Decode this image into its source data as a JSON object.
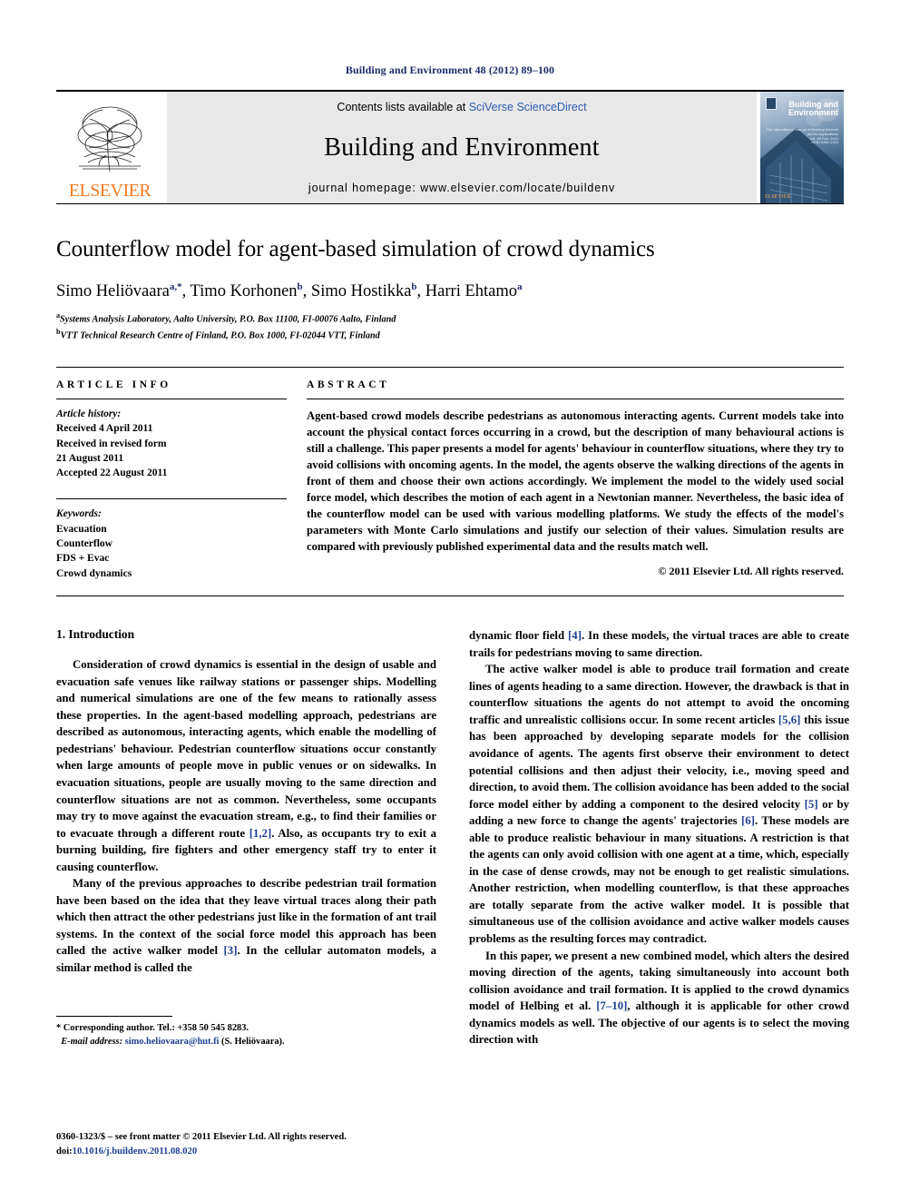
{
  "running_head": "Building and Environment 48 (2012) 89–100",
  "masthead": {
    "publisher_name": "ELSEVIER",
    "contents_prefix": "Contents lists available at ",
    "contents_link": "SciVerse ScienceDirect",
    "journal_title": "Building and Environment",
    "homepage_line": "journal homepage: www.elsevier.com/locate/buildenv",
    "cover_title_line1": "Building and",
    "cover_title_line2": "Environment",
    "cover_subtitle": "The International Journal of Building Science and its Applications",
    "cover_volume": "Vol. 48  Feb. 2012",
    "cover_issn": "ISSN 0360-1323",
    "cover_publisher": "ELSEVIER"
  },
  "article": {
    "title": "Counterflow model for agent-based simulation of crowd dynamics",
    "authors_html": "Simo Heliövaara<sup>a,*</sup>, Timo Korhonen<sup>b</sup>, Simo Hostikka<sup>b</sup>, Harri Ehtamo<sup>a</sup>",
    "affiliation_a": "Systems Analysis Laboratory, Aalto University, P.O. Box 11100, FI-00076 Aalto, Finland",
    "affiliation_b": "VTT Technical Research Centre of Finland, P.O. Box 1000, FI-02044 VTT, Finland"
  },
  "article_info": {
    "heading": "ARTICLE INFO",
    "history_label": "Article history:",
    "history": [
      "Received 4 April 2011",
      "Received in revised form",
      "21 August 2011",
      "Accepted 22 August 2011"
    ],
    "keywords_label": "Keywords:",
    "keywords": [
      "Evacuation",
      "Counterflow",
      "FDS + Evac",
      "Crowd dynamics"
    ]
  },
  "abstract": {
    "heading": "ABSTRACT",
    "text": "Agent-based crowd models describe pedestrians as autonomous interacting agents. Current models take into account the physical contact forces occurring in a crowd, but the description of many behavioural actions is still a challenge. This paper presents a model for agents' behaviour in counterflow situations, where they try to avoid collisions with oncoming agents. In the model, the agents observe the walking directions of the agents in front of them and choose their own actions accordingly. We implement the model to the widely used social force model, which describes the motion of each agent in a Newtonian manner. Nevertheless, the basic idea of the counterflow model can be used with various modelling platforms. We study the effects of the model's parameters with Monte Carlo simulations and justify our selection of their values. Simulation results are compared with previously published experimental data and the results match well.",
    "copyright": "© 2011 Elsevier Ltd. All rights reserved."
  },
  "body": {
    "section_title": "1. Introduction",
    "left_paragraphs": [
      "Consideration of crowd dynamics is essential in the design of usable and evacuation safe venues like railway stations or passenger ships. Modelling and numerical simulations are one of the few means to rationally assess these properties. In the agent-based modelling approach, pedestrians are described as autonomous, interacting agents, which enable the modelling of pedestrians' behaviour. Pedestrian counterflow situations occur constantly when large amounts of people move in public venues or on sidewalks. In evacuation situations, people are usually moving to the same direction and counterflow situations are not as common. Nevertheless, some occupants may try to move against the evacuation stream, e.g., to find their families or to evacuate through a different route [1,2]. Also, as occupants try to exit a burning building, fire fighters and other emergency staff try to enter it causing counterflow.",
      "Many of the previous approaches to describe pedestrian trail formation have been based on the idea that they leave virtual traces along their path which then attract the other pedestrians just like in the formation of ant trail systems. In the context of the social force model this approach has been called the active walker model [3]. In the cellular automaton models, a similar method is called the"
    ],
    "right_paragraphs": [
      "dynamic floor field [4]. In these models, the virtual traces are able to create trails for pedestrians moving to same direction.",
      "The active walker model is able to produce trail formation and create lines of agents heading to a same direction. However, the drawback is that in counterflow situations the agents do not attempt to avoid the oncoming traffic and unrealistic collisions occur. In some recent articles [5,6] this issue has been approached by developing separate models for the collision avoidance of agents. The agents first observe their environment to detect potential collisions and then adjust their velocity, i.e., moving speed and direction, to avoid them. The collision avoidance has been added to the social force model either by adding a component to the desired velocity [5] or by adding a new force to change the agents' trajectories [6]. These models are able to produce realistic behaviour in many situations. A restriction is that the agents can only avoid collision with one agent at a time, which, especially in the case of dense crowds, may not be enough to get realistic simulations. Another restriction, when modelling counterflow, is that these approaches are totally separate from the active walker model. It is possible that simultaneous use of the collision avoidance and active walker models causes problems as the resulting forces may contradict.",
      "In this paper, we present a new combined model, which alters the desired moving direction of the agents, taking simultaneously into account both collision avoidance and trail formation. It is applied to the crowd dynamics model of Helbing et al. [7–10], although it is applicable for other crowd dynamics models as well. The objective of our agents is to select the moving direction with"
    ]
  },
  "footnotes": {
    "corresponding": "* Corresponding author. Tel.: +358 50 545 8283.",
    "email_label": "E-mail address:",
    "email": "simo.heliovaara@hut.fi",
    "email_suffix": "(S. Heliövaara)."
  },
  "imprint": {
    "line1": "0360-1323/$ – see front matter © 2011 Elsevier Ltd. All rights reserved.",
    "doi_label": "doi:",
    "doi": "10.1016/j.buildenv.2011.08.020"
  }
}
